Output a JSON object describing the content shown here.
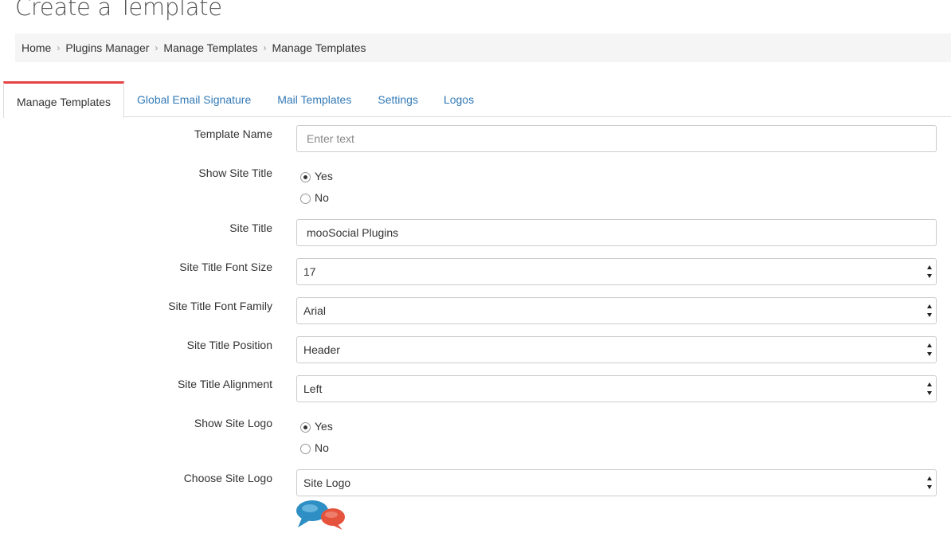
{
  "page": {
    "title": "Create a Template"
  },
  "breadcrumb": [
    "Home",
    "Plugins Manager",
    "Manage Templates",
    "Manage Templates"
  ],
  "tabs": [
    {
      "label": "Manage Templates",
      "active": true
    },
    {
      "label": "Global Email Signature",
      "active": false
    },
    {
      "label": "Mail Templates",
      "active": false
    },
    {
      "label": "Settings",
      "active": false
    },
    {
      "label": "Logos",
      "active": false
    }
  ],
  "form": {
    "template_name": {
      "label": "Template Name",
      "value": "",
      "placeholder": "Enter text"
    },
    "show_site_title": {
      "label": "Show Site Title",
      "options": [
        "Yes",
        "No"
      ],
      "selected": "Yes"
    },
    "site_title": {
      "label": "Site Title",
      "value": "mooSocial Plugins"
    },
    "site_title_font_size": {
      "label": "Site Title Font Size",
      "value": "17"
    },
    "site_title_font_family": {
      "label": "Site Title Font Family",
      "value": "Arial"
    },
    "site_title_position": {
      "label": "Site Title Position",
      "value": "Header"
    },
    "site_title_alignment": {
      "label": "Site Title Alignment",
      "value": "Left"
    },
    "show_site_logo": {
      "label": "Show Site Logo",
      "options": [
        "Yes",
        "No"
      ],
      "selected": "Yes"
    },
    "choose_site_logo": {
      "label": "Choose Site Logo",
      "value": "Site Logo"
    }
  },
  "colors": {
    "accent": "#e54343",
    "link": "#337ab7",
    "logo_blue": "#2e8fc4",
    "logo_red": "#e5533d"
  }
}
